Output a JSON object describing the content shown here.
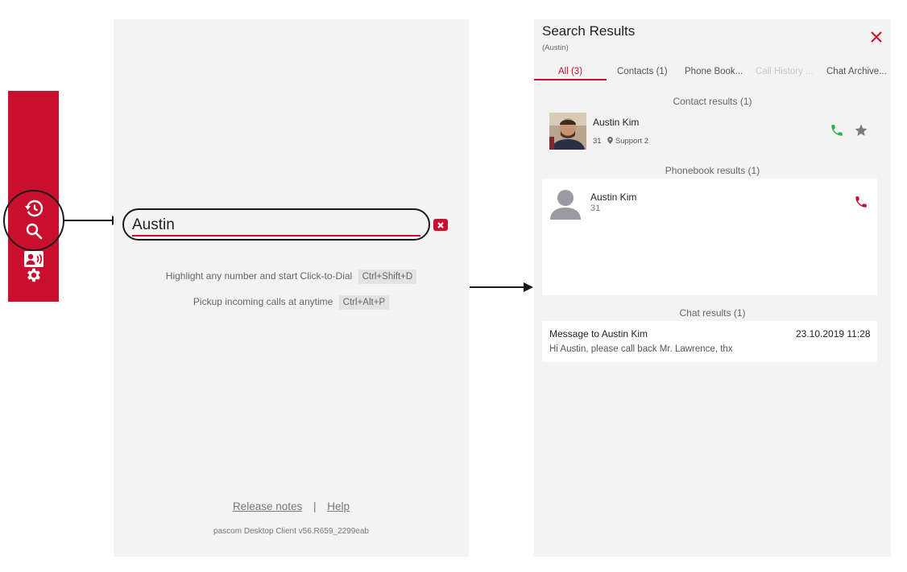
{
  "sidebar": {
    "items": [
      {
        "icon": "history-icon"
      },
      {
        "icon": "contacts-icon"
      },
      {
        "icon": "search-icon"
      },
      {
        "icon": "gear-icon"
      }
    ]
  },
  "search": {
    "value": "Austin",
    "placeholder": ""
  },
  "hints": {
    "click_to_dial": "Highlight any number and start Click-to-Dial",
    "click_to_dial_key": "Ctrl+Shift+D",
    "pickup": "Pickup incoming calls at anytime",
    "pickup_key": "Ctrl+Alt+P"
  },
  "footer": {
    "release_notes": "Release notes",
    "separator": "|",
    "help": "Help",
    "version": "pascom Desktop Client v56.R659_2299eab"
  },
  "results": {
    "title": "Search Results",
    "query": "(Austin)",
    "tabs": [
      {
        "label": "All (3)",
        "state": "active"
      },
      {
        "label": "Contacts (1)",
        "state": "normal"
      },
      {
        "label": "Phone Book...",
        "state": "normal"
      },
      {
        "label": "Call History ...",
        "state": "disabled"
      },
      {
        "label": "Chat Archive...",
        "state": "normal"
      }
    ],
    "contact_section": "Contact results (1)",
    "contact": {
      "name": "Austin Kim",
      "extension": "31",
      "location": "Support 2"
    },
    "phonebook_section": "Phonebook results (1)",
    "phonebook": {
      "name": "Austin Kim",
      "number": "31"
    },
    "chat_section": "Chat results (1)",
    "chat": {
      "title": "Message to Austin Kim",
      "timestamp": "23.10.2019 11:28",
      "message": "Hi Austin, please call back Mr. Lawrence, thx"
    }
  },
  "colors": {
    "brand": "#c8102e",
    "call_green": "#2bb24c",
    "panel_bg": "#f3f3f4"
  }
}
